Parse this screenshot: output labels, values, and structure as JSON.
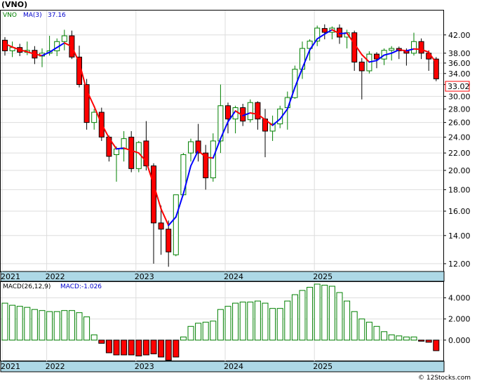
{
  "header": {
    "title": "(VNO)",
    "ticker_label": "VNO",
    "ma_label": "MA(3)",
    "ma_value": "37.16",
    "ticker_color": "#008000",
    "ma_color": "#0000cc"
  },
  "macd_panel": {
    "label": "MACD(26,12,9)",
    "value_label": "MACD:-1.026"
  },
  "watermark": "© 12Stocks.com",
  "colors": {
    "up_candle": "#008000",
    "down_candle": "#ff0000",
    "ma_up": "#0000ff",
    "ma_down": "#ff0000",
    "macd_pos": "#008000",
    "macd_neg": "#ff0000",
    "axis_band": "#add8e6",
    "grid": "#dddddd",
    "price_tag": "#ff0000"
  },
  "chart_data": [
    {
      "type": "candlestick",
      "title": "(VNO)",
      "y_scale": "log",
      "ylim": [
        11.5,
        48
      ],
      "yticks": [
        "12.00",
        "14.00",
        "16.00",
        "18.00",
        "20.00",
        "22.00",
        "24.00",
        "26.00",
        "28.00",
        "30.00",
        "32.00",
        "34.00",
        "36.00",
        "38.00",
        "42.00"
      ],
      "ytick_values": [
        12,
        14,
        16,
        18,
        20,
        22,
        24,
        26,
        28,
        30,
        32,
        34,
        36,
        38,
        42
      ],
      "last_price_label": "33.02",
      "x_labels": [
        {
          "label": "2021",
          "index": 0
        },
        {
          "label": "2022",
          "index": 6
        },
        {
          "label": "2023",
          "index": 18
        },
        {
          "label": "2024",
          "index": 30
        },
        {
          "label": "2025",
          "index": 42
        }
      ],
      "ohlc": [
        [
          40.8,
          41.5,
          37.5,
          38.5
        ],
        [
          38.5,
          40.5,
          37.2,
          39.2
        ],
        [
          39.2,
          40.0,
          37.4,
          38.2
        ],
        [
          38.2,
          40.5,
          37.6,
          38.6
        ],
        [
          38.6,
          39.5,
          35.8,
          37.0
        ],
        [
          37.4,
          39.0,
          35.2,
          38.0
        ],
        [
          38.0,
          41.8,
          37.5,
          38.5
        ],
        [
          38.5,
          41.2,
          37.4,
          40.5
        ],
        [
          40.5,
          43.2,
          38.6,
          41.8
        ],
        [
          41.8,
          43.0,
          36.8,
          37.2
        ],
        [
          37.2,
          39.6,
          31.5,
          32.0
        ],
        [
          32.0,
          33.0,
          25.0,
          26.0
        ],
        [
          26.0,
          28.0,
          25.0,
          27.5
        ],
        [
          27.5,
          28.2,
          23.5,
          24.0
        ],
        [
          24.0,
          24.2,
          21.0,
          21.6
        ],
        [
          21.8,
          22.8,
          18.8,
          22.5
        ],
        [
          22.5,
          24.8,
          21.0,
          23.8
        ],
        [
          24.0,
          24.8,
          19.8,
          20.2
        ],
        [
          20.2,
          23.5,
          19.8,
          23.3
        ],
        [
          23.5,
          26.2,
          20.0,
          20.5
        ],
        [
          20.5,
          20.8,
          12.0,
          15.0
        ],
        [
          15.0,
          16.5,
          12.6,
          14.5
        ],
        [
          14.5,
          15.2,
          11.8,
          12.8
        ],
        [
          12.6,
          17.5,
          12.5,
          17.5
        ],
        [
          17.5,
          22.0,
          17.4,
          21.8
        ],
        [
          22.0,
          23.8,
          21.0,
          23.4
        ],
        [
          23.5,
          25.8,
          21.0,
          22.0
        ],
        [
          22.0,
          23.0,
          18.0,
          19.2
        ],
        [
          19.2,
          24.5,
          18.8,
          23.5
        ],
        [
          23.5,
          32.0,
          22.0,
          28.5
        ],
        [
          28.5,
          29.0,
          24.5,
          26.5
        ],
        [
          26.5,
          28.5,
          24.5,
          28.2
        ],
        [
          28.2,
          28.8,
          25.5,
          26.2
        ],
        [
          26.4,
          29.5,
          26.0,
          29.0
        ],
        [
          29.0,
          29.2,
          25.0,
          26.5
        ],
        [
          26.5,
          28.0,
          21.5,
          24.8
        ],
        [
          24.8,
          27.0,
          23.5,
          25.8
        ],
        [
          25.8,
          28.5,
          25.2,
          28.0
        ],
        [
          28.2,
          30.8,
          25.0,
          29.8
        ],
        [
          29.8,
          35.5,
          29.6,
          34.8
        ],
        [
          34.8,
          40.5,
          33.0,
          39.0
        ],
        [
          39.0,
          41.0,
          36.5,
          40.6
        ],
        [
          40.6,
          44.2,
          39.5,
          43.6
        ],
        [
          43.5,
          44.5,
          41.0,
          42.6
        ],
        [
          42.6,
          44.0,
          41.0,
          43.6
        ],
        [
          43.6,
          44.5,
          40.0,
          41.5
        ],
        [
          41.5,
          43.2,
          39.0,
          42.5
        ],
        [
          42.5,
          43.0,
          34.5,
          36.2
        ],
        [
          36.2,
          37.0,
          29.5,
          34.5
        ],
        [
          34.5,
          38.4,
          34.0,
          37.8
        ],
        [
          37.8,
          38.2,
          35.0,
          36.8
        ],
        [
          36.8,
          39.0,
          35.6,
          38.6
        ],
        [
          38.6,
          39.5,
          36.5,
          39.0
        ],
        [
          39.0,
          39.4,
          36.8,
          38.5
        ],
        [
          38.5,
          39.0,
          35.5,
          38.0
        ],
        [
          38.0,
          42.5,
          37.5,
          40.5
        ],
        [
          40.5,
          41.2,
          36.8,
          38.0
        ],
        [
          38.0,
          38.6,
          34.5,
          36.8
        ],
        [
          36.8,
          37.2,
          32.6,
          33.02
        ]
      ],
      "ma3": [
        40.0,
        39.3,
        38.7,
        38.3,
        37.8,
        37.5,
        38.2,
        39.2,
        40.2,
        39.4,
        36.1,
        31.0,
        28.4,
        25.8,
        23.9,
        22.5,
        22.6,
        22.3,
        22.0,
        21.0,
        18.5,
        16.2,
        14.8,
        15.5,
        17.6,
        20.5,
        22.3,
        21.5,
        21.4,
        23.8,
        26.1,
        27.7,
        27.0,
        27.4,
        27.2,
        26.4,
        25.6,
        26.5,
        28.0,
        31.5,
        35.0,
        38.7,
        41.1,
        42.2,
        43.2,
        42.3,
        42.4,
        40.0,
        37.7,
        36.2,
        36.5,
        37.6,
        38.0,
        38.7,
        38.5,
        38.9,
        38.8,
        38.2,
        36.0
      ]
    },
    {
      "type": "bar",
      "title": "MACD(26,12,9)",
      "ylim": [
        -2.0,
        5.5
      ],
      "yticks": [
        "4.000",
        "2.000",
        "0.000"
      ],
      "ytick_values": [
        4,
        2,
        0
      ],
      "values": [
        3.5,
        3.3,
        3.2,
        3.1,
        2.9,
        2.8,
        2.7,
        2.7,
        2.8,
        2.8,
        2.6,
        2.2,
        0.5,
        -0.3,
        -1.2,
        -1.4,
        -1.4,
        -1.4,
        -1.5,
        -1.4,
        -1.3,
        -1.6,
        -1.9,
        -1.6,
        0.3,
        1.3,
        1.6,
        1.7,
        1.8,
        2.9,
        3.2,
        3.5,
        3.6,
        3.6,
        3.7,
        3.5,
        3.0,
        3.0,
        3.7,
        4.3,
        4.7,
        5.0,
        5.3,
        5.2,
        5.1,
        4.5,
        3.7,
        2.7,
        2.0,
        1.7,
        1.3,
        0.8,
        0.5,
        0.4,
        0.3,
        0.3,
        -0.1,
        -0.2,
        -1.0
      ]
    }
  ]
}
